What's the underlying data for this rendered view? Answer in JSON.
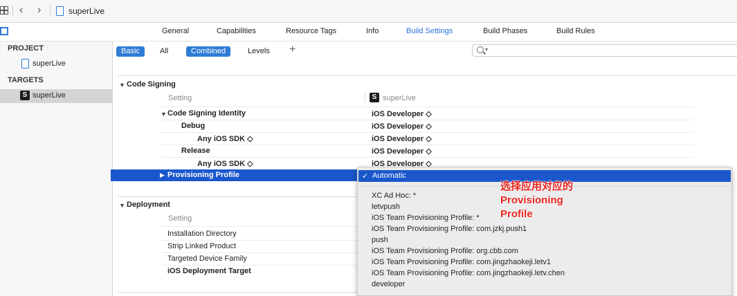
{
  "pathbar": {
    "crumb": "superLive"
  },
  "tabs": [
    "General",
    "Capabilities",
    "Resource Tags",
    "Info",
    "Build Settings",
    "Build Phases",
    "Build Rules"
  ],
  "active_tab": "Build Settings",
  "sidebar": {
    "project_header": "PROJECT",
    "project_item": "superLive",
    "targets_header": "TARGETS",
    "target_item": "superLive"
  },
  "filterbar": {
    "basic": "Basic",
    "all": "All",
    "combined": "Combined",
    "levels": "Levels",
    "plus": "+"
  },
  "code_signing": {
    "title": "Code Signing",
    "col_setting": "Setting",
    "col_target": "superLive",
    "rows": [
      {
        "label": "Code Signing Identity",
        "value": "iOS Developer ◇"
      },
      {
        "label": "Debug",
        "value": "iOS Developer ◇"
      },
      {
        "label": "Any iOS SDK ◇",
        "value": "iOS Developer ◇"
      },
      {
        "label": "Release",
        "value": "iOS Developer ◇"
      },
      {
        "label": "Any iOS SDK ◇",
        "value": "iOS Developer ◇"
      }
    ],
    "selected_row": "Provisioning Profile"
  },
  "deployment": {
    "title": "Deployment",
    "col_setting": "Setting",
    "rows": [
      "Installation Directory",
      "Strip Linked Product",
      "Targeted Device Family",
      "iOS Deployment Target"
    ]
  },
  "dropdown": {
    "selected": "Automatic",
    "check": "✓",
    "options": [
      "XC Ad Hoc: *",
      "letvpush",
      "iOS Team Provisioning Profile: *",
      "iOS Team Provisioning Profile: com.jzkj.push1",
      "push",
      "iOS Team Provisioning Profile: org.cbb.com",
      "iOS Team Provisioning Profile: com.jingzhaokeji.letv1",
      "iOS Team Provisioning Profile: com.jingzhaokeji.letv.chen",
      "developer"
    ]
  },
  "annotation": {
    "line1": "选择应用对应的",
    "line2": "Provisioning",
    "line3": "Profile"
  },
  "colors": {
    "accent": "#2f7cd6",
    "selection": "#1a57cc",
    "annotation": "#e8231e"
  }
}
